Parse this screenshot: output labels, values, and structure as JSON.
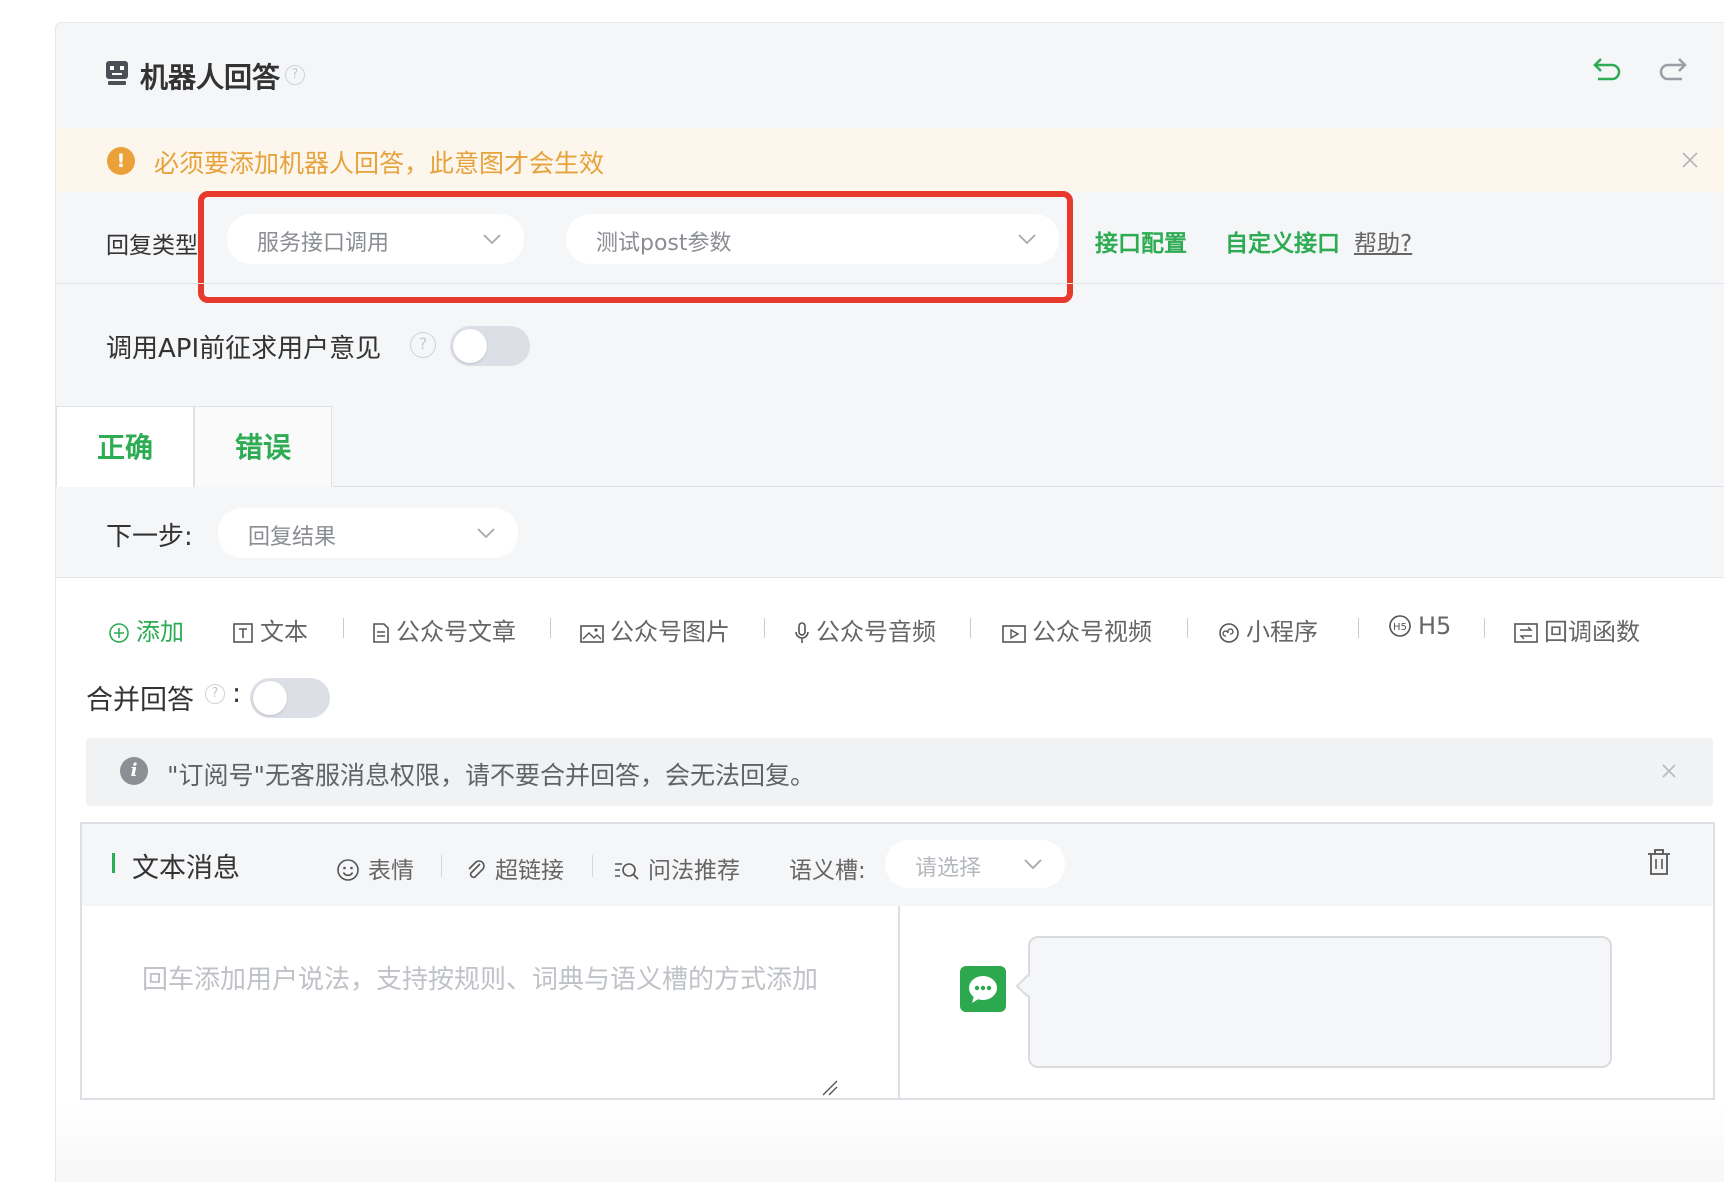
{
  "header": {
    "title": "机器人回答",
    "help_glyph": "?",
    "undo_icon": "undo-icon",
    "redo_icon": "redo-icon"
  },
  "warning": {
    "icon_glyph": "!",
    "text": "必须要添加机器人回答，此意图才会生效",
    "color": "#e6a23c"
  },
  "reply_type": {
    "label": "回复类型:",
    "service_select": "服务接口调用",
    "api_select": "测试post参数",
    "config_link": "接口配置",
    "custom_link": "自定义接口",
    "help_link": "帮助?"
  },
  "consent": {
    "label": "调用API前征求用户意见",
    "help_glyph": "?",
    "enabled": false
  },
  "tabs": [
    {
      "label": "正确",
      "active": true
    },
    {
      "label": "错误",
      "active": false
    }
  ],
  "next_step": {
    "label": "下一步:",
    "value": "回复结果"
  },
  "toolbar": {
    "add": "添加",
    "text": "文本",
    "article": "公众号文章",
    "image": "公众号图片",
    "audio": "公众号音频",
    "video": "公众号视频",
    "mini_program": "小程序",
    "h5": "H5",
    "callback": "回调函数"
  },
  "merge": {
    "label": "合并回答",
    "help_glyph": "?",
    "colon": ":",
    "enabled": false
  },
  "info": {
    "icon_glyph": "i",
    "text": "\"订阅号\"无客服消息权限，请不要合并回答，会无法回复。"
  },
  "message_card": {
    "title": "文本消息",
    "emoji": "表情",
    "link": "超链接",
    "suggest": "问法推荐",
    "slot_label": "语义槽:",
    "slot_placeholder": "请选择",
    "input_placeholder": "回车添加用户说法，支持按规则、词典与语义槽的方式添加"
  },
  "colors": {
    "accent": "#2dac53",
    "highlight": "#e8392d",
    "warning": "#e6a23c"
  }
}
